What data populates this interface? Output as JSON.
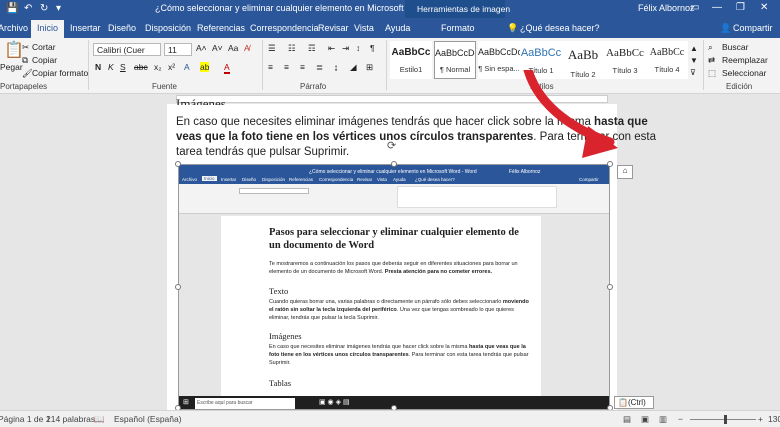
{
  "window": {
    "title": "¿Cómo seleccionar y eliminar cualquier elemento en Microsoft Word  -  Word",
    "context_tab": "Herramientas de imagen",
    "user": "Félix Albornoz"
  },
  "tabs": [
    "Archivo",
    "Inicio",
    "Insertar",
    "Diseño",
    "Disposición",
    "Referencias",
    "Correspondencia",
    "Revisar",
    "Vista",
    "Ayuda",
    "Formato",
    "¿Qué desea hacer?",
    "Compartir"
  ],
  "ribbon": {
    "paste": "Pegar",
    "cut": "Cortar",
    "copy": "Copiar",
    "format_painter": "Copiar formato",
    "font_name": "Calibri (Cuer",
    "font_size": "11",
    "group_clipboard": "Portapapeles",
    "group_font": "Fuente",
    "group_paragraph": "Párrafo",
    "group_styles": "Estilos",
    "group_editing": "Edición",
    "styles": [
      {
        "preview": "AaBbCc",
        "name": "Estilo1"
      },
      {
        "preview": "AaBbCcDc",
        "name": "¶ Normal"
      },
      {
        "preview": "AaBbCcDc",
        "name": "¶ Sin espa..."
      },
      {
        "preview": "AaBbCc",
        "name": "Título 1"
      },
      {
        "preview": "AaBb",
        "name": "Título 2"
      },
      {
        "preview": "AaBbCc",
        "name": "Título 3"
      },
      {
        "preview": "AaBbCc",
        "name": "Título 4"
      }
    ],
    "find": "Buscar",
    "replace": "Reemplazar",
    "select": "Seleccionar"
  },
  "document": {
    "heading_partial": "Imágenes",
    "line1_a": "En caso que necesites eliminar imágenes tendrás que hacer ",
    "line1_b": "click sobre la misma ",
    "line1_c": "hasta que",
    "line2_a": "veas que la foto tiene en los vértices unos círculos transparentes",
    "line2_b": ". Para terminar con esta",
    "line3": "tarea tendrás que pulsar Suprimir."
  },
  "embedded": {
    "title": "¿Cómo seleccionar y eliminar cualquier elemento en Microsoft Word  -  Word",
    "user": "Félix Albornoz",
    "tabs": [
      "Archivo",
      "Inicio",
      "Insertar",
      "Diseño",
      "Disposición",
      "Referencias",
      "Correspondencia",
      "Revisar",
      "Vista",
      "Ayuda",
      "¿Qué desea hacer?",
      "Compartir"
    ],
    "heading": "Pasos para seleccionar y eliminar cualquier elemento de un documento de Word",
    "intro": "Te mostraremos a continuación los pasos que deberás seguir en diferentes situaciones para borrar un elemento de un documento de Microsoft Word.",
    "intro_bold": "Presta atención para no cometer errores.",
    "texto_h": "Texto",
    "texto_p": "Cuando quieras borrar una, varias palabras o directamente un párrafo sólo debes seleccionarlo",
    "texto_p2_bold": "moviendo el ratón sin soltar la tecla izquierda del periférico",
    "texto_p2": ". Una vez que tengas sombreado",
    "texto_p3": "lo que quieres eliminar, tendrás que pulsar la tecla Suprimir.",
    "img_h": "Imágenes",
    "img_p": "En caso que necesites eliminar imágenes tendrás que hacer click sobre la misma",
    "img_p_bold": "hasta que",
    "img_p2_bold": "veas que la foto tiene en los vértices unos círculos transparentes",
    "img_p2": ". Para terminar con esta",
    "img_p3": "tarea tendrás que pulsar Suprimir.",
    "tablas_h": "Tablas",
    "taskbar_search": "Escribe aquí para buscar"
  },
  "status": {
    "page": "Página 1 de 1",
    "words": "214 palabras",
    "language": "Español (España)",
    "paste_options": "(Ctrl)",
    "zoom": "130"
  },
  "colors": {
    "brand": "#2b579a",
    "arrow": "#d9232d"
  }
}
